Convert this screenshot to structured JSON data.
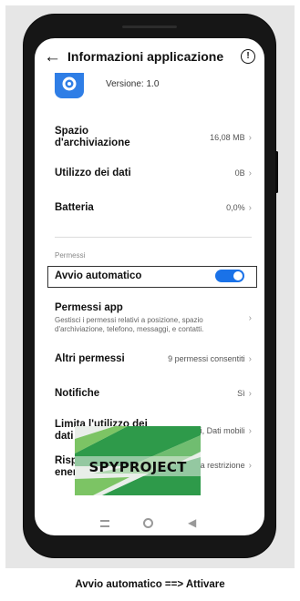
{
  "header": {
    "title": "Informazioni applicazione"
  },
  "app": {
    "version": "Versione: 1.0"
  },
  "rows": {
    "storage": {
      "label": "Spazio d'archiviazione",
      "value": "16,08 MB"
    },
    "data": {
      "label": "Utilizzo dei dati",
      "value": "0B"
    },
    "battery": {
      "label": "Batteria",
      "value": "0,0%"
    }
  },
  "section": {
    "permissions": "Permessi"
  },
  "autostart": {
    "label": "Avvio automatico",
    "enabled": true
  },
  "perm_app": {
    "label": "Permessi app",
    "description": "Gestisci i permessi relativi a posizione, spazio d'archiviazione, telefono, messaggi, e contatti."
  },
  "other_perm": {
    "label": "Altri permessi",
    "value": "9 permessi consentiti"
  },
  "notifications": {
    "label": "Notifiche",
    "value": "Sì"
  },
  "data_limit": {
    "label": "Limita l'utilizzo dei dati",
    "value": "Wi-Fi, Dati mobili"
  },
  "energy": {
    "label": "Risparmio energeti",
    "value": "Nessuna restrizione"
  },
  "watermark": {
    "text": "SPYPROJECT"
  },
  "caption": "Avvio automatico ==> Attivare",
  "colors": {
    "accent": "#1a72e8",
    "panel": "#e6e6e6",
    "phone": "#161616",
    "logo_green": "#2e9a4a"
  }
}
